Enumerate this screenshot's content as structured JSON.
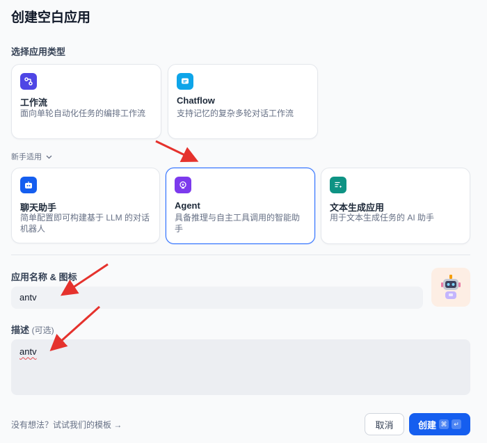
{
  "dialog": {
    "title": "创建空白应用",
    "app_type_label": "选择应用类型",
    "beginner_label": "新手适用"
  },
  "app_types": [
    {
      "name": "工作流",
      "desc": "面向单轮自动化任务的编排工作流",
      "icon": "workflow-icon",
      "color": "#4f46e5"
    },
    {
      "name": "Chatflow",
      "desc": "支持记忆的复杂多轮对话工作流",
      "icon": "chatflow-icon",
      "color": "#0ea5e9"
    }
  ],
  "beginner_types": [
    {
      "name": "聊天助手",
      "desc": "简单配置即可构建基于 LLM 的对话机器人",
      "icon": "chatbot-icon",
      "color": "#155eef"
    },
    {
      "name": "Agent",
      "desc": "具备推理与自主工具调用的智能助手",
      "icon": "agent-icon",
      "color": "#7c3aed",
      "selected": true
    },
    {
      "name": "文本生成应用",
      "desc": "用于文本生成任务的 AI 助手",
      "icon": "text-generation-icon",
      "color": "#0e9384"
    }
  ],
  "name_field": {
    "label": "应用名称 & 图标",
    "value": "antv"
  },
  "description_field": {
    "label": "描述",
    "optional": "(可选)",
    "value": "antv"
  },
  "footer": {
    "template_link": "没有想法？试试我们的模板 →",
    "cancel": "取消",
    "create": "创建",
    "shortcut_cmd": "⌘",
    "shortcut_enter": "↵"
  },
  "colors": {
    "accent": "#155eef",
    "selected_border": "#296dff",
    "annotation_arrow": "#e5322d"
  }
}
